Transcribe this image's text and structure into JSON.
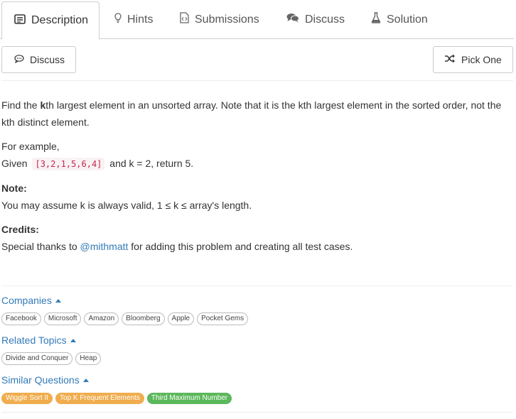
{
  "tabs": [
    {
      "label": "Description",
      "icon": "description-icon",
      "active": true
    },
    {
      "label": "Hints",
      "icon": "lightbulb-icon"
    },
    {
      "label": "Submissions",
      "icon": "code-file-icon"
    },
    {
      "label": "Discuss",
      "icon": "comments-icon"
    },
    {
      "label": "Solution",
      "icon": "flask-icon"
    }
  ],
  "toolbar": {
    "discuss_label": "Discuss",
    "pick_one_label": "Pick One"
  },
  "problem": {
    "line1_pre": "Find the ",
    "line1_bold": "k",
    "line1_post": "th largest element in an unsorted array. Note that it is the kth largest element in the sorted order, not the kth distinct element.",
    "example_intro": "For example,",
    "given_label": "Given",
    "given_array": "[3,2,1,5,6,4]",
    "given_rest": "and k = 2, return 5.",
    "note_heading": "Note:",
    "note_text": "You may assume k is always valid, 1 ≤ k ≤ array's length.",
    "credits_heading": "Credits:",
    "credits_pre": "Special thanks to ",
    "credits_user": "@mithmatt",
    "credits_post": " for adding this problem and creating all test cases."
  },
  "companies": {
    "title": "Companies",
    "items": [
      "Facebook",
      "Microsoft",
      "Amazon",
      "Bloomberg",
      "Apple",
      "Pocket Gems"
    ]
  },
  "related_topics": {
    "title": "Related Topics",
    "items": [
      "Divide and Conquer",
      "Heap"
    ]
  },
  "similar_questions": {
    "title": "Similar Questions",
    "items": [
      {
        "label": "Wiggle Sort II",
        "difficulty": "medium",
        "color": "#f0ad4e"
      },
      {
        "label": "Top K Frequent Elements",
        "difficulty": "medium",
        "color": "#f0ad4e"
      },
      {
        "label": "Third Maximum Number",
        "difficulty": "easy",
        "color": "#5cb85c"
      }
    ]
  },
  "colors": {
    "link": "#337ab7",
    "code_text": "#c7254e",
    "code_bg": "#f9f2f4",
    "medium": "#f0ad4e",
    "easy": "#5cb85c"
  }
}
